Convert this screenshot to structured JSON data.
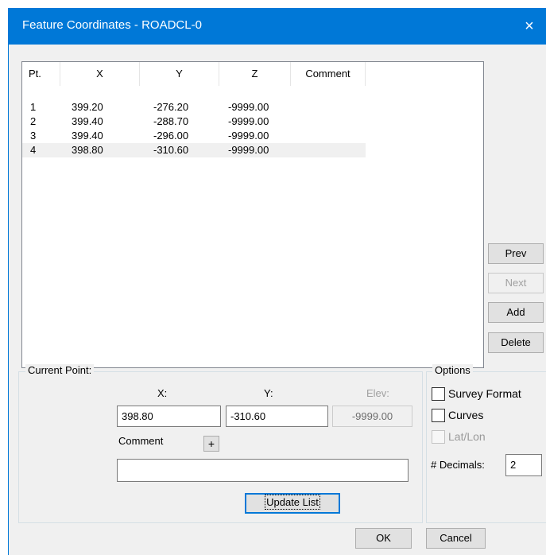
{
  "window": {
    "title": "Feature Coordinates - ROADCL-0",
    "close_glyph": "×"
  },
  "list": {
    "columns": [
      "Pt.",
      "X",
      "Y",
      "Z",
      "Comment"
    ],
    "rows": [
      [
        "1",
        "399.20",
        "-276.20",
        "-9999.00",
        ""
      ],
      [
        "2",
        "399.40",
        "-288.70",
        "-9999.00",
        ""
      ],
      [
        "3",
        "399.40",
        "-296.00",
        "-9999.00",
        ""
      ],
      [
        "4",
        "398.80",
        "-310.60",
        "-9999.00",
        ""
      ]
    ],
    "selected_row": 4
  },
  "side_buttons": {
    "prev": "Prev",
    "next": "Next",
    "add": "Add",
    "delete": "Delete"
  },
  "current_point": {
    "label": "Current Point:",
    "x_label": "X:",
    "y_label": "Y:",
    "elev_label": "Elev:",
    "x_value": "398.80",
    "y_value": "-310.60",
    "elev_value": "-9999.00",
    "comment_label": "Comment",
    "comment_plus": "+",
    "comment_value": "",
    "update_label": "Update List"
  },
  "options": {
    "label": "Options",
    "survey_format": "Survey Format",
    "curves": "Curves",
    "lat_lon": "Lat/Lon",
    "decimals_label": "# Decimals:",
    "decimals_value": "2"
  },
  "footer": {
    "ok": "OK",
    "cancel": "Cancel"
  },
  "colors": {
    "titlebar": "#0078d7",
    "dialog": "#f0f0f0",
    "selected_row": "#f0f0f0"
  }
}
